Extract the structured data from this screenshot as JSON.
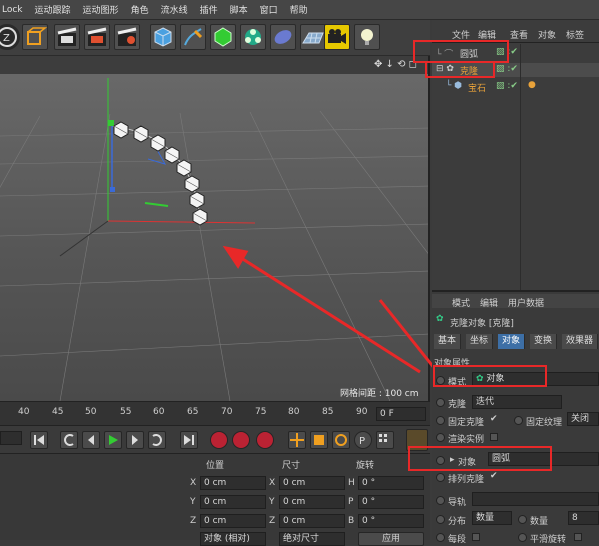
{
  "menu": [
    "Lock",
    "运动跟踪",
    "运动图形",
    "角色",
    "流水线",
    "插件",
    "脚本",
    "窗口",
    "帮助"
  ],
  "viewport": {
    "grid_spacing_label": "网格间距 : 100 cm"
  },
  "timeline": {
    "ticks": [
      "40",
      "45",
      "50",
      "55",
      "60",
      "65",
      "70",
      "75",
      "80",
      "85",
      "90"
    ],
    "frame_field": "0 F"
  },
  "coords": {
    "headers": [
      "位置",
      "尺寸",
      "旋转"
    ],
    "rows": [
      {
        "axis": "X",
        "pos": "0 cm",
        "size_axis": "X",
        "size": "0 cm",
        "rot_axis": "H",
        "rot": "0 °"
      },
      {
        "axis": "Y",
        "pos": "0 cm",
        "size_axis": "Y",
        "size": "0 cm",
        "rot_axis": "P",
        "rot": "0 °"
      },
      {
        "axis": "Z",
        "pos": "0 cm",
        "size_axis": "Z",
        "size": "0 cm",
        "rot_axis": "B",
        "rot": "0 °"
      }
    ],
    "mode_select": "对象 (相对)",
    "size_select": "绝对尺寸",
    "apply_button": "应用"
  },
  "object_manager": {
    "menu": [
      "文件",
      "编辑",
      "查看",
      "对象",
      "标签"
    ],
    "items": [
      {
        "name": "圆弧"
      },
      {
        "name": "克隆"
      },
      {
        "name": "宝石"
      }
    ]
  },
  "attribute_manager": {
    "menu": [
      "模式",
      "编辑",
      "用户数据"
    ],
    "header": "克隆对象 [克隆]",
    "tabs": [
      "基本",
      "坐标",
      "对象",
      "变换",
      "效果器"
    ],
    "active_tab": "对象",
    "section_title": "对象属性",
    "mode_label": "模式",
    "mode_value": "对象",
    "clone_label": "克隆",
    "clone_value": "迭代",
    "fix_clone_label": "固定克隆",
    "fix_texture_label": "固定纹理",
    "fix_texture_value": "关闭",
    "render_instances_label": "渲染实例",
    "object_label": "对象",
    "object_value": "圆弧",
    "arrange_clones_label": "排列克隆",
    "guide_label": "导轨",
    "distribution_label": "分布",
    "distribution_value": "数量",
    "count_label": "数量",
    "count_value": "8",
    "offset_label": "每段",
    "smooth_rotation_label": "平滑旋转"
  },
  "colors": {
    "highlight_box": "#e82828",
    "active_tab": "#3d6fa6",
    "object_selected": "#e8a23a"
  }
}
